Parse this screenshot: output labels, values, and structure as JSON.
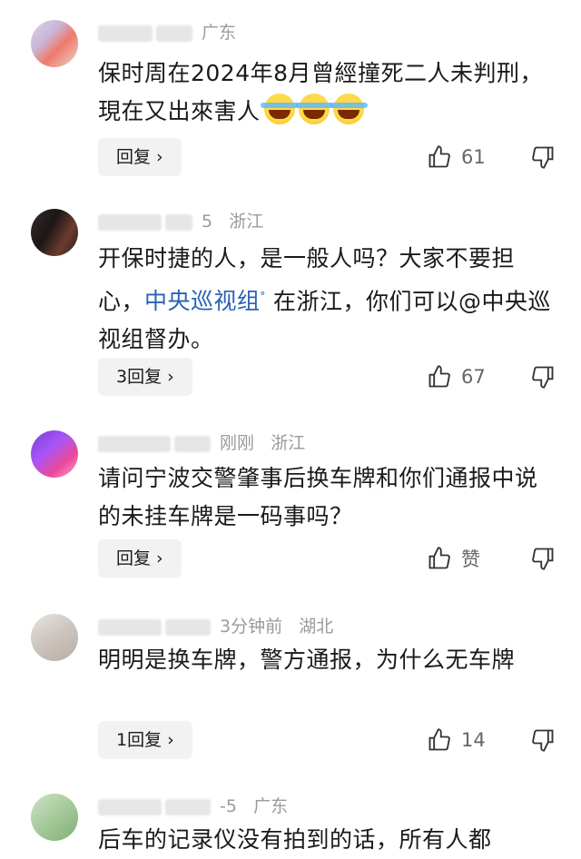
{
  "comments": [
    {
      "location": "广东",
      "text_parts": [
        "保时周在2024年8月曾經撞死二人未判刑，現在又出來害人"
      ],
      "emoji": "laughing-crying-emoji",
      "reply_label": "回复 ›",
      "likes": "61"
    },
    {
      "meta_partial": "5",
      "location": "浙江",
      "text_before": "开保时捷的人，是一般人吗？大家不要担心，",
      "link_text": "中央巡视组",
      "search_mark": "ᐤ",
      "text_after": "在浙江，你们可以@中央巡视组督办。",
      "reply_label": "3回复 ›",
      "likes": "67"
    },
    {
      "meta_partial": "刚刚",
      "location": "浙江",
      "text": "请问宁波交警肇事后换车牌和你们通报中说的未挂车牌是一码事吗？",
      "reply_label": "回复 ›",
      "likes": "赞"
    },
    {
      "meta_partial": "3分钟前",
      "location": "湖北",
      "text": "明明是换车牌，警方通报，为什么无车牌",
      "reply_label": "1回复 ›",
      "likes": "14"
    },
    {
      "meta_partial": "-5",
      "location": "广东",
      "text": "后车的记录仪没有拍到的话，所有人都"
    }
  ],
  "colors": {
    "link": "#2a63b5",
    "meta": "#9a9a9a",
    "reply_bg": "#f2f2f2"
  }
}
